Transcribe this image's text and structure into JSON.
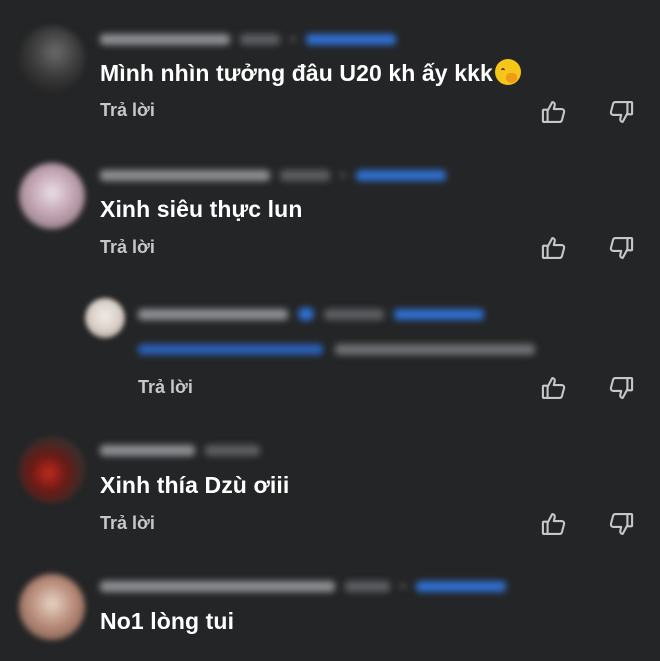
{
  "comments": [
    {
      "text": "Mình nhìn tưởng đâu U20 kh ấy kkk",
      "emoji_icon": "hand-over-mouth-emoji",
      "reply_label": "Trả lời"
    },
    {
      "text": "Xinh siêu thực lun",
      "reply_label": "Trả lời"
    },
    {
      "reply_label": "Trả lời"
    },
    {
      "text": "Xinh thía Dzù ơiii",
      "reply_label": "Trả lời"
    },
    {
      "text": "No1 lòng tui"
    }
  ],
  "icons": {
    "like": "thumbs-up-icon",
    "dislike": "thumbs-down-icon"
  },
  "colors": {
    "background": "#242526",
    "text": "#ffffff",
    "secondary_text": "#c5c7cb",
    "link": "#2f6fd0"
  }
}
